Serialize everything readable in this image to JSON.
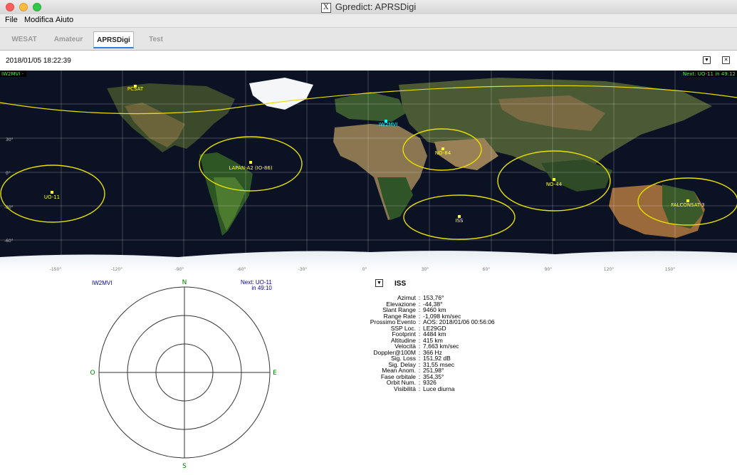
{
  "window": {
    "title": "Gpredict: APRSDigi",
    "x_glyph": "X"
  },
  "menu": {
    "file": "File",
    "edit": "Modifica",
    "help": "Aiuto"
  },
  "tabs": [
    {
      "label": "WESAT"
    },
    {
      "label": "Amateur"
    },
    {
      "label": "APRSDigi"
    },
    {
      "label": "Test"
    }
  ],
  "module": {
    "timestamp": "2018/01/05 18:22:39"
  },
  "map": {
    "qth_corner": "IW2MVI -",
    "next_corner": "Next: UO-11 in 49:12",
    "qth_name": "IW2MVI",
    "lat_labels": [
      "30°",
      "0°",
      "-30°",
      "-60°"
    ],
    "lon_labels": [
      "-150°",
      "-120°",
      "-90°",
      "-60°",
      "-30°",
      "0°",
      "30°",
      "60°",
      "90°",
      "120°",
      "150°"
    ],
    "satellites": [
      {
        "name": "UO-11"
      },
      {
        "name": "LAPAN-A2 (IO-86)"
      },
      {
        "name": "NO-84"
      },
      {
        "name": "NO-44"
      },
      {
        "name": "ISS"
      },
      {
        "name": "FALCONSAT-3"
      },
      {
        "name": "PCSAT"
      }
    ]
  },
  "polar": {
    "qth": "IW2MVI",
    "next_line1": "Next: UO-11",
    "next_line2": "in 49:10",
    "north": "N",
    "south": "S",
    "east": "E",
    "west": "O"
  },
  "info": {
    "title": "ISS",
    "rows": [
      {
        "key": "Azimut",
        "value": "153,76°"
      },
      {
        "key": "Elevazione",
        "value": "-44,38°"
      },
      {
        "key": "Slant Range",
        "value": "9460 km"
      },
      {
        "key": "Range Rate",
        "value": "-1,098 km/sec"
      },
      {
        "key": "Prossimo Evento",
        "value": "AOS: 2018/01/06 00:56:06"
      },
      {
        "key": "SSP Loc.",
        "value": "LE29GD"
      },
      {
        "key": "Footprint",
        "value": "4484 km"
      },
      {
        "key": "Altitudine",
        "value": "415 km"
      },
      {
        "key": "Velocità",
        "value": "7,663 km/sec"
      },
      {
        "key": "Doppler@100M",
        "value": "366 Hz"
      },
      {
        "key": "Sig. Loss",
        "value": "151,92 dB"
      },
      {
        "key": "Sig. Delay",
        "value": "31,55 msec"
      },
      {
        "key": "Mean Anom.",
        "value": "251,98°"
      },
      {
        "key": "Fase orbitale",
        "value": "354,35°"
      },
      {
        "key": "Orbit Num.",
        "value": "9326"
      },
      {
        "key": "Visibilità",
        "value": "Luce diurna"
      }
    ]
  },
  "colors": {
    "sat_yellow": "#ffff33",
    "footprint_yellow": "#e8e000",
    "qth_cyan": "#00ffff",
    "corner_green": "#33ff33",
    "polar_green": "#008000"
  }
}
